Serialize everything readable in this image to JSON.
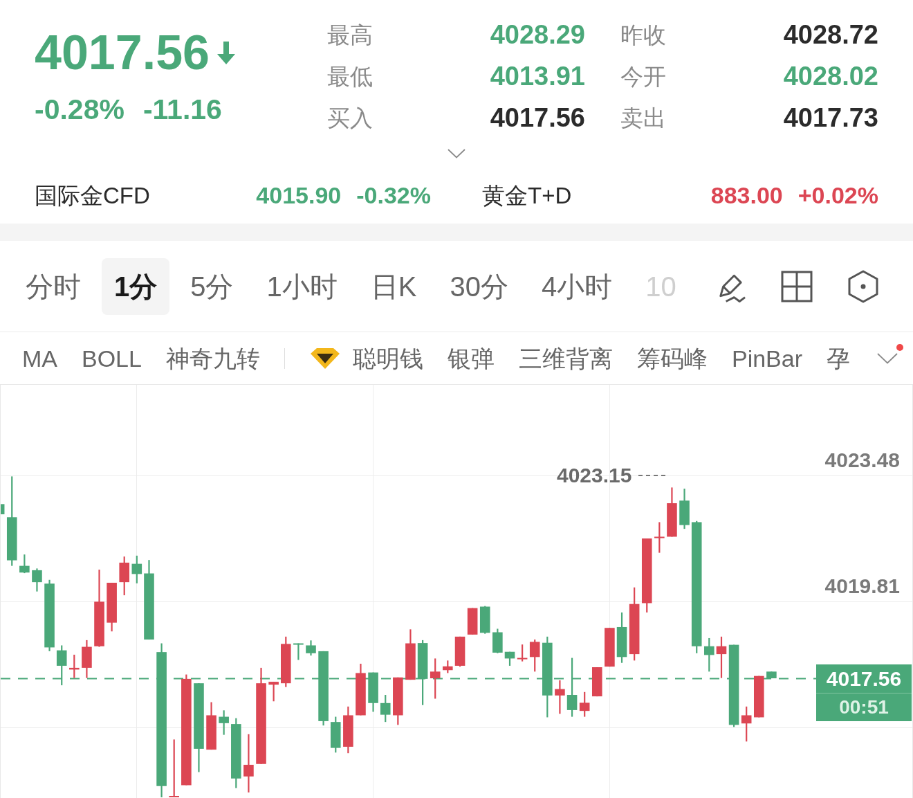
{
  "quote": {
    "price": "4017.56",
    "falling": true,
    "change_percent": "-0.28%",
    "change": "-11.16"
  },
  "stats": [
    {
      "label": "最高",
      "value": "4028.29",
      "color": "#4aa879"
    },
    {
      "label": "昨收",
      "value": "4028.72",
      "color": "#2b2b2b"
    },
    {
      "label": "最低",
      "value": "4013.91",
      "color": "#4aa879"
    },
    {
      "label": "今开",
      "value": "4028.02",
      "color": "#4aa879"
    },
    {
      "label": "买入",
      "value": "4017.56",
      "color": "#2b2b2b"
    },
    {
      "label": "卖出",
      "value": "4017.73",
      "color": "#2b2b2b"
    }
  ],
  "related_markets": [
    {
      "name": "国际金CFD",
      "price": "4015.90",
      "change_percent": "-0.32%",
      "color": "#4aa879"
    },
    {
      "name": "黄金T+D",
      "price": "883.00",
      "change_percent": "+0.02%",
      "color": "#dc4653"
    }
  ],
  "periods": [
    {
      "label": "分时",
      "selected": false
    },
    {
      "label": "1分",
      "selected": true
    },
    {
      "label": "5分",
      "selected": false
    },
    {
      "label": "1小时",
      "selected": false
    },
    {
      "label": "日K",
      "selected": false
    },
    {
      "label": "30分",
      "selected": false
    },
    {
      "label": "4小时",
      "selected": false
    },
    {
      "label": "10",
      "selected": false
    }
  ],
  "indicators": {
    "standard": [
      {
        "label": "MA"
      },
      {
        "label": "BOLL"
      },
      {
        "label": "神奇九转"
      }
    ],
    "special": [
      {
        "label": "聪明钱",
        "featured": true
      },
      {
        "label": "银弹",
        "featured": false
      },
      {
        "label": "三维背离",
        "featured": false
      },
      {
        "label": "筹码峰",
        "featured": false
      },
      {
        "label": "PinBar",
        "featured": false
      },
      {
        "label": "孕",
        "featured": false
      }
    ]
  },
  "indicator_menu": {
    "has_update": true
  },
  "chart": {
    "axis_labels": [
      "4023.48",
      "4019.81"
    ],
    "high_label": "4023.15",
    "last_price": "4017.56",
    "countdown": "00:51"
  }
}
